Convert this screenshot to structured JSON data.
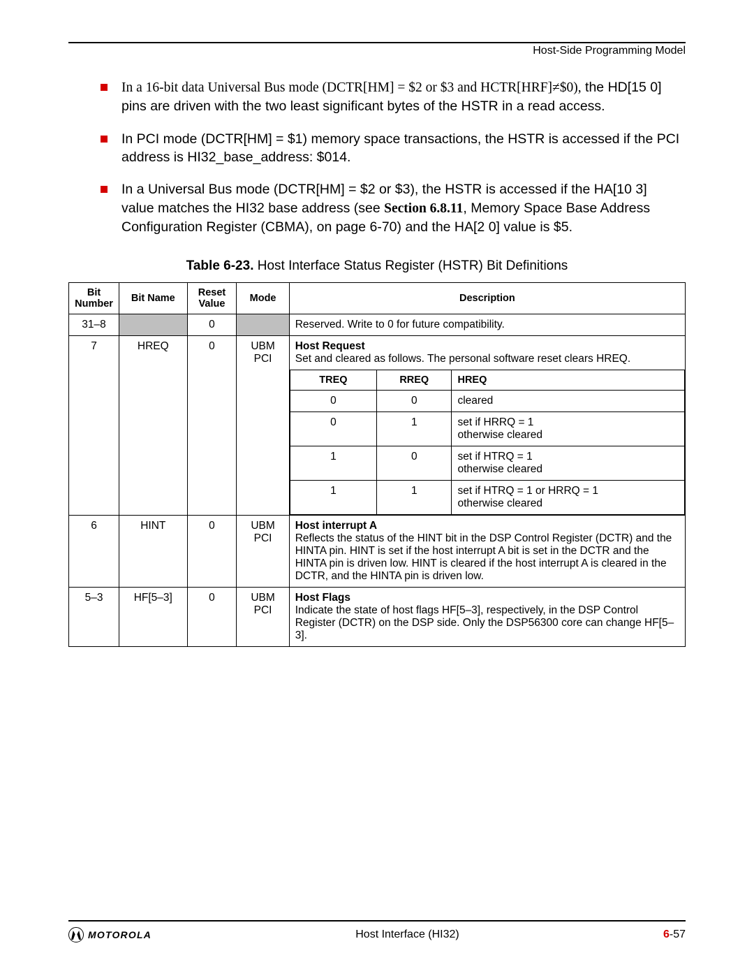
{
  "header": {
    "section": "Host-Side Programming Model"
  },
  "bullets": [
    {
      "lead_serif": "In a 16-bit data Universal Bus mode (DCTR[HM] = $2 or $3 and HCTR[HRF]≠$0),",
      "rest": "the HD[15 0] pins are driven with the two least significant bytes of the HSTR in a read access."
    },
    {
      "text": "In PCI mode (DCTR[HM] = $1) memory space transactions, the HSTR is accessed if the PCI address is HI32_base_address: $014."
    },
    {
      "pre": "In a Universal Bus mode (DCTR[HM] = $2 or $3), the HSTR is accessed if the HA[10 3] value matches the HI32 base address (see ",
      "serif_mid": "Section 6.8.11",
      "post": ",  Memory Space Base Address Configuration Register (CBMA), on page 6-70) and the HA[2 0] value  is $5."
    }
  ],
  "table_caption": {
    "label": "Table 6-23.",
    "title": " Host Interface Status Register (HSTR) Bit Definitions"
  },
  "table": {
    "headers": {
      "bit": "Bit Number",
      "name": "Bit Name",
      "reset": "Reset Value",
      "mode": "Mode",
      "desc": "Description"
    },
    "rows": [
      {
        "bit": "31–8",
        "name": "",
        "reset": "0",
        "mode": "",
        "desc_plain": "Reserved. Write to 0 for future compatibility.",
        "shade_name": true,
        "shade_mode": true
      },
      {
        "bit": "7",
        "name": "HREQ",
        "reset": "0",
        "mode": "UBM PCI",
        "desc_title": "Host Request",
        "desc_body": "Set and cleared as follows. The personal software reset clears HREQ.",
        "inner": {
          "headers": {
            "a": "TREQ",
            "b": "RREQ",
            "c": "HREQ"
          },
          "rows": [
            {
              "a": "0",
              "b": "0",
              "c": "cleared"
            },
            {
              "a": "0",
              "b": "1",
              "c": "set if HRRQ = 1\notherwise cleared"
            },
            {
              "a": "1",
              "b": "0",
              "c": "set if HTRQ = 1\notherwise cleared"
            },
            {
              "a": "1",
              "b": "1",
              "c": "set if HTRQ = 1 or HRRQ = 1\notherwise cleared"
            }
          ]
        }
      },
      {
        "bit": "6",
        "name": "HINT",
        "reset": "0",
        "mode": "UBM PCI",
        "desc_title": "Host interrupt A",
        "desc_body": "Reflects the status of the HINT bit in the DSP Control Register (DCTR) and the HINTA pin. HINT is set if the host interrupt A bit is set in the DCTR and the HINTA pin is driven low. HINT is cleared if the host interrupt A is cleared in the DCTR, and the HINTA pin is driven low."
      },
      {
        "bit": "5–3",
        "name": "HF[5–3]",
        "reset": "0",
        "mode": "UBM PCI",
        "desc_title": "Host Flags",
        "desc_body": "Indicate the state of host flags HF[5–3], respectively, in the DSP Control Register (DCTR) on the DSP side. Only the DSP56300 core can change HF[5–3]."
      }
    ]
  },
  "footer": {
    "brand": "MOTOROLA",
    "center": "Host Interface (HI32)",
    "page_prefix": "6",
    "page_suffix": "-57"
  }
}
